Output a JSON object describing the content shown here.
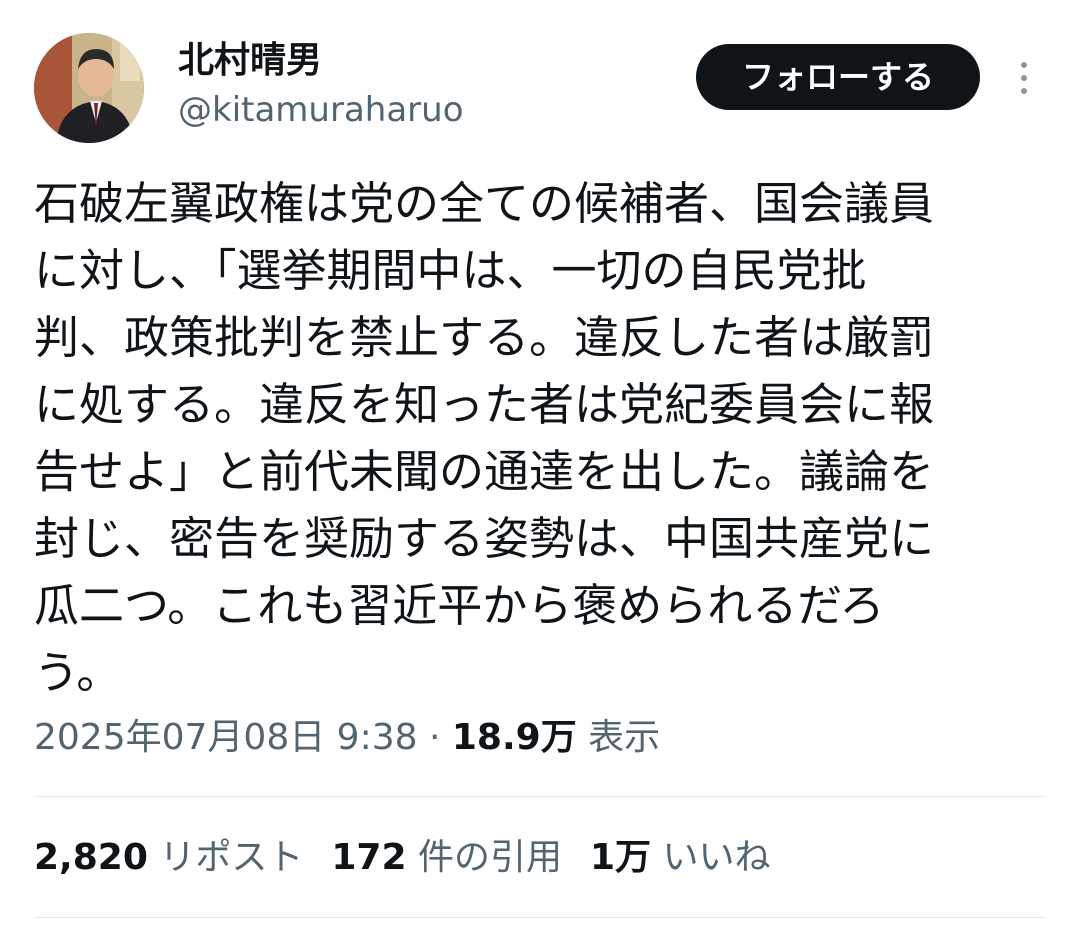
{
  "author": {
    "display_name": "北村晴男",
    "handle": "@kitamuraharuo",
    "avatar_icon": "user-photo-avatar"
  },
  "follow_button_label": "フォローする",
  "more_icon": "more-vertical-icon",
  "tweet": {
    "text": "石破左翼政権は党の全ての候補者、国会議員\nに対し、「選挙期間中は、一切の自民党批\n判、政策批判を禁止する。違反した者は厳罰\nに処する。違反を知った者は党紀委員会に報\n告せよ」と前代未聞の通達を出した。議論を\n封じ、密告を奨励する姿勢は、中国共産党に\n瓜二つ。これも習近平から褒められるだろ\nう。"
  },
  "meta": {
    "timestamp": "2025年07月08日 9:38",
    "separator": " · ",
    "views_count": "18.9万",
    "views_label": "表示"
  },
  "stats": {
    "reposts": {
      "count": "2,820",
      "label": "リポスト"
    },
    "quotes": {
      "count": "172",
      "label": "件の引用"
    },
    "likes": {
      "count": "1万",
      "label": "いいね"
    }
  },
  "colors": {
    "text_primary": "#0f1419",
    "text_secondary": "#536471",
    "button_bg": "#0f1419",
    "button_text": "#ffffff",
    "divider": "#e6e9ec"
  }
}
